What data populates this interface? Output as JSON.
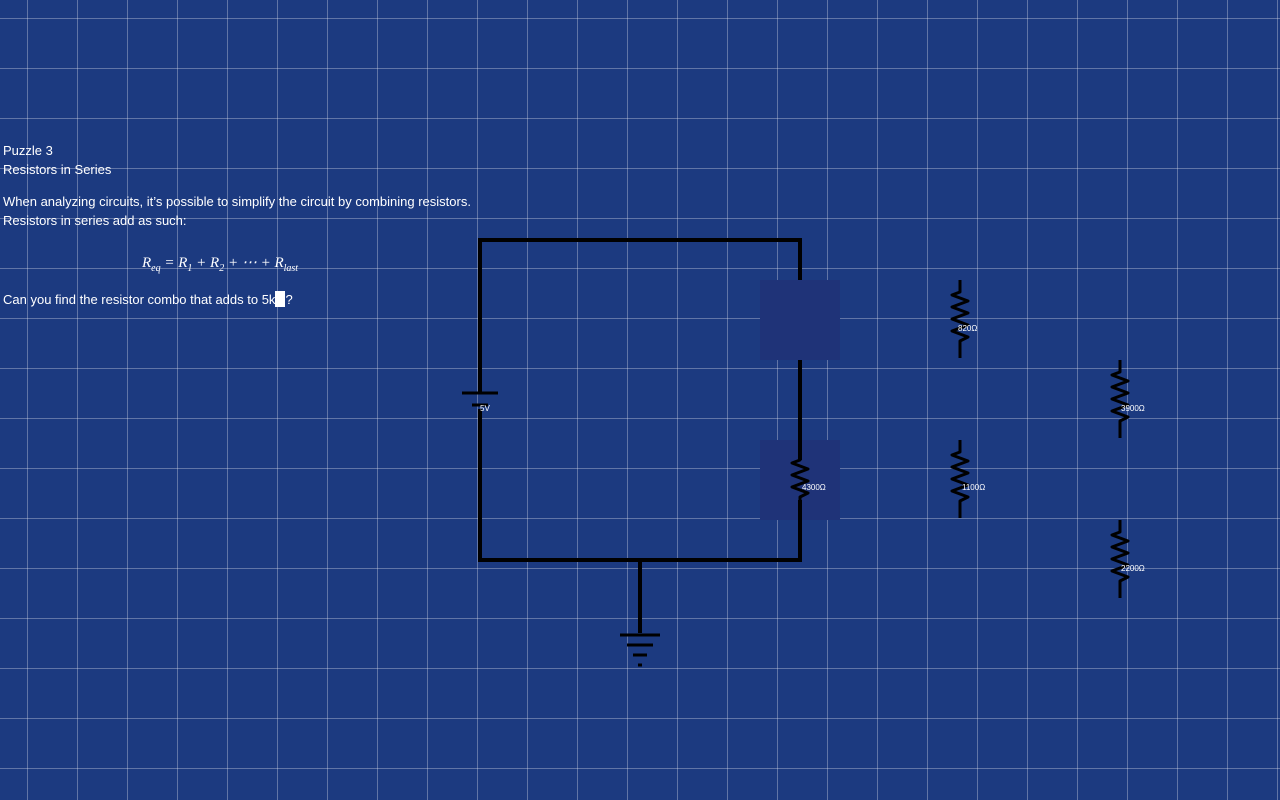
{
  "puzzle": {
    "title": "Puzzle 3",
    "subtitle": "Resistors in Series",
    "intro": "When analyzing circuits, it’s possible to simplify the circuit by combining resistors. Resistors in series add as such:",
    "question_before": "Can you find the resistor combo that adds to 5k",
    "question_after": "?"
  },
  "formula": {
    "lhs": "R",
    "lhs_sub": "eq",
    "t1": "R",
    "t1_sub": "1",
    "t2": "R",
    "t2_sub": "2",
    "dots": "⋯",
    "last": "R",
    "last_sub": "last"
  },
  "battery": {
    "label": "5V"
  },
  "placed_resistors": [
    {
      "value": "4300Ω"
    }
  ],
  "available_resistors": [
    {
      "value": "820Ω"
    },
    {
      "value": "1100Ω"
    },
    {
      "value": "3900Ω"
    },
    {
      "value": "2200Ω"
    }
  ],
  "colors": {
    "background": "#1c3a80",
    "grid": "#ffffff",
    "slot": "#1f3378",
    "wire": "#000000"
  }
}
